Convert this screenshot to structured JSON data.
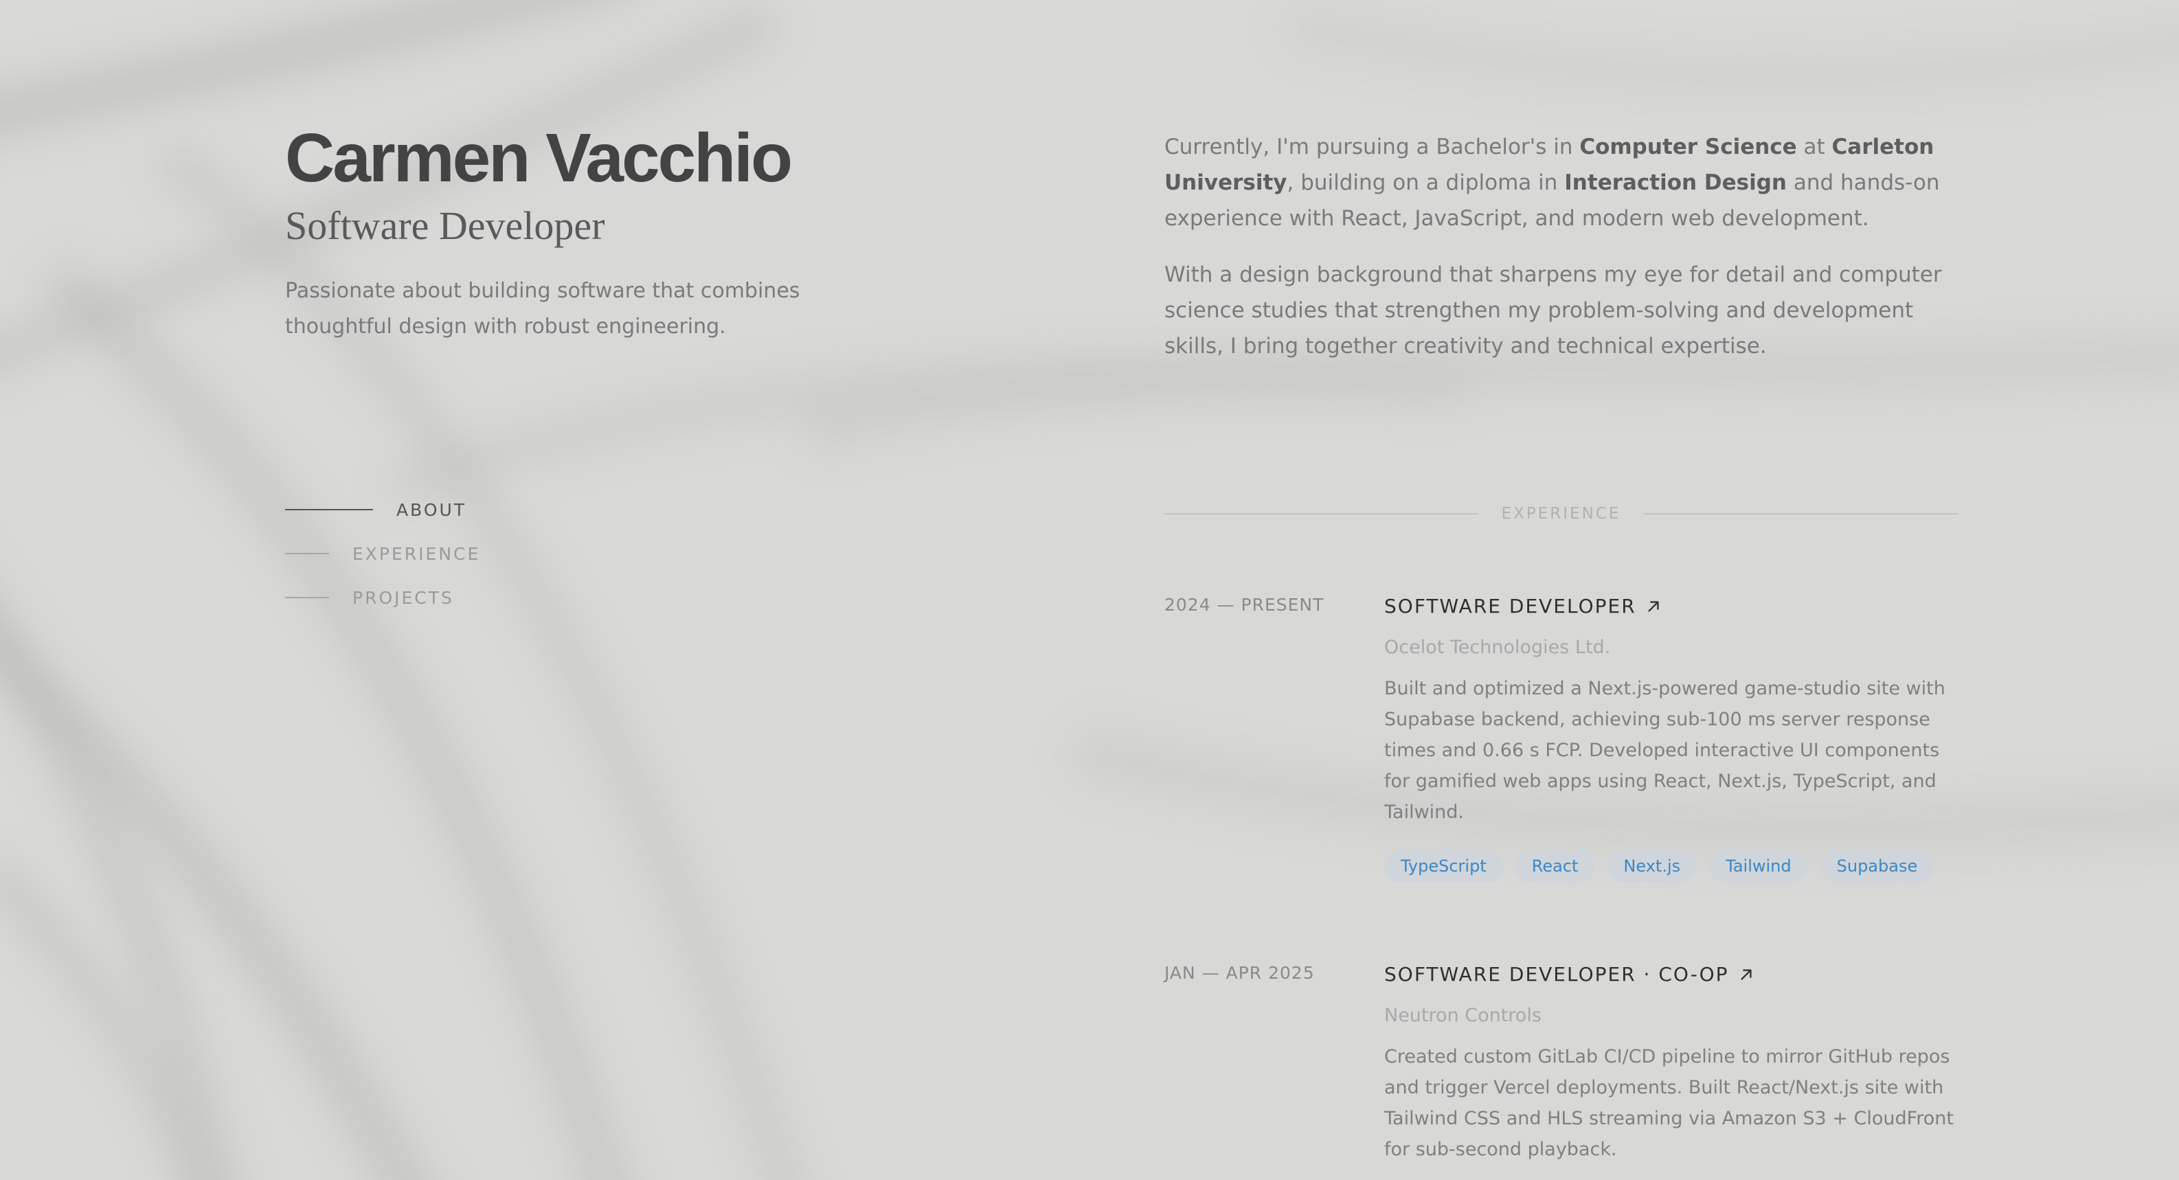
{
  "profile": {
    "name": "Carmen Vacchio",
    "role": "Software Developer",
    "intro": "Passionate about building software that combines thoughtful design with robust engineering."
  },
  "nav": {
    "items": [
      {
        "label": "ABOUT",
        "active": true
      },
      {
        "label": "EXPERIENCE",
        "active": false
      },
      {
        "label": "PROJECTS",
        "active": false
      }
    ]
  },
  "about": {
    "p1": {
      "t1": "Currently, I'm pursuing a Bachelor's in ",
      "b1": "Computer Science",
      "t2": " at ",
      "b2": "Carleton University",
      "t3": ", building on a diploma in ",
      "b3": "Interaction Design",
      "t4": " and hands-on experience with React, JavaScript, and modern web development."
    },
    "p2": "With a design background that sharpens my eye for detail and computer science studies that strengthen my problem-solving and development skills, I bring together creativity and technical expertise."
  },
  "experience": {
    "section_title": "EXPERIENCE",
    "jobs": [
      {
        "period": "2024 — PRESENT",
        "title": "SOFTWARE DEVELOPER",
        "company": "Ocelot Technologies Ltd.",
        "description": "Built and optimized a Next.js-powered game-studio site with Supabase backend, achieving sub-100 ms server response times and 0.66 s FCP. Developed interactive UI components for gamified web apps using React, Next.js, TypeScript, and Tailwind.",
        "tags": [
          "TypeScript",
          "React",
          "Next.js",
          "Tailwind",
          "Supabase"
        ]
      },
      {
        "period": "JAN — APR 2025",
        "title": "SOFTWARE DEVELOPER · CO-OP",
        "company": "Neutron Controls",
        "description": "Created custom GitLab CI/CD pipeline to mirror GitHub repos and trigger Vercel deployments. Built React/Next.js site with Tailwind CSS and HLS streaming via Amazon S3 + CloudFront for sub-second playback."
      }
    ]
  },
  "colors": {
    "background": "#d8d8d6",
    "heading": "#434343",
    "tag_bg": "#cfd5da",
    "tag_text": "#3d86c6"
  }
}
